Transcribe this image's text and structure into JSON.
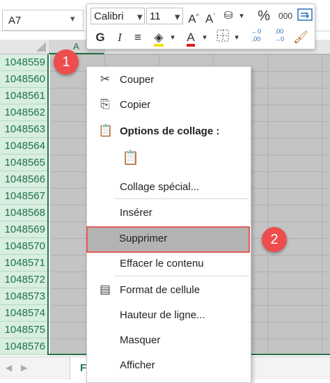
{
  "name_box": {
    "value": "A7"
  },
  "column_header": "A",
  "row_numbers": [
    "1048559",
    "1048560",
    "1048561",
    "1048562",
    "1048563",
    "1048564",
    "1048565",
    "1048566",
    "1048567",
    "1048568",
    "1048569",
    "1048570",
    "1048571",
    "1048572",
    "1048573",
    "1048574",
    "1048575",
    "1048576"
  ],
  "mini_toolbar": {
    "font_name": "Calibri",
    "font_size": "11",
    "bold": "G",
    "italic": "I",
    "percent": "%",
    "thousands": "000",
    "increase_decimal_top": "←0",
    "increase_decimal_bottom": ",00",
    "decrease_decimal_top": ",00",
    "decrease_decimal_bottom": "→0"
  },
  "context_menu": {
    "cut": "Couper",
    "copy": "Copier",
    "paste_options": "Options de collage :",
    "paste_special": "Collage spécial...",
    "insert": "Insérer",
    "delete": "Supprimer",
    "clear_contents": "Effacer le contenu",
    "format_cells": "Format de cellule",
    "row_height": "Hauteur de ligne...",
    "hide": "Masquer",
    "unhide": "Afficher"
  },
  "badges": {
    "step1": "1",
    "step2": "2"
  },
  "sheet_tab": "F",
  "colors": {
    "excel_green": "#217346",
    "badge_red": "#ed4d4d",
    "selection_gray": "#c4c4c4"
  }
}
